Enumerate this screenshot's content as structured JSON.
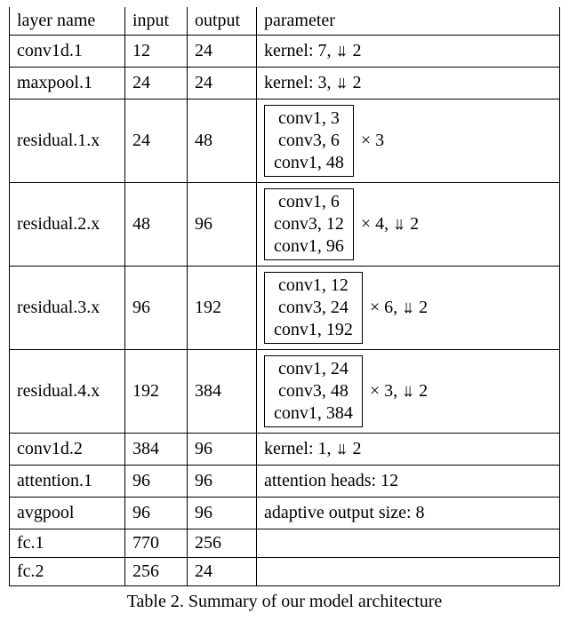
{
  "headers": {
    "layer": "layer name",
    "input": "input",
    "output": "output",
    "param": "parameter"
  },
  "glyphs": {
    "downsample": "↓↓",
    "times": "×"
  },
  "rows": [
    {
      "layer": "conv1d.1",
      "input": "12",
      "output": "24",
      "param_text": "kernel: 7, ↓↓ 2"
    },
    {
      "layer": "maxpool.1",
      "input": "24",
      "output": "24",
      "param_text": "kernel: 3, ↓↓ 2"
    },
    {
      "layer": "residual.1.x",
      "input": "24",
      "output": "48",
      "block": {
        "lines": [
          "conv1, 3",
          "conv3, 6",
          "conv1, 48"
        ]
      },
      "after": "× 3"
    },
    {
      "layer": "residual.2.x",
      "input": "48",
      "output": "96",
      "block": {
        "lines": [
          "conv1, 6",
          "conv3, 12",
          "conv1, 96"
        ]
      },
      "after": "× 4, ↓↓ 2"
    },
    {
      "layer": "residual.3.x",
      "input": "96",
      "output": "192",
      "block": {
        "lines": [
          "conv1, 12",
          "conv3, 24",
          "conv1, 192"
        ]
      },
      "after": "× 6, ↓↓ 2"
    },
    {
      "layer": "residual.4.x",
      "input": "192",
      "output": "384",
      "block": {
        "lines": [
          "conv1, 24",
          "conv3, 48",
          "conv1, 384"
        ]
      },
      "after": "× 3, ↓↓ 2"
    },
    {
      "layer": "conv1d.2",
      "input": "384",
      "output": "96",
      "param_text": "kernel: 1, ↓↓ 2"
    },
    {
      "layer": "attention.1",
      "input": "96",
      "output": "96",
      "param_text": "attention heads: 12"
    },
    {
      "layer": "avgpool",
      "input": "96",
      "output": "96",
      "param_text": "adaptive output size: 8"
    },
    {
      "layer": "fc.1",
      "input": "770",
      "output": "256",
      "param_text": ""
    },
    {
      "layer": "fc.2",
      "input": "256",
      "output": "24",
      "param_text": ""
    }
  ],
  "caption": "Table 2.  Summary of our model architecture",
  "chart_data": {
    "type": "table",
    "title": "Summary of our model architecture",
    "columns": [
      "layer name",
      "input",
      "output",
      "parameter"
    ],
    "rows": [
      [
        "conv1d.1",
        12,
        24,
        "kernel: 7, stride 2"
      ],
      [
        "maxpool.1",
        24,
        24,
        "kernel: 3, stride 2"
      ],
      [
        "residual.1.x",
        24,
        48,
        "[conv1,3; conv3,6; conv1,48] × 3"
      ],
      [
        "residual.2.x",
        48,
        96,
        "[conv1,6; conv3,12; conv1,96] × 4, stride 2"
      ],
      [
        "residual.3.x",
        96,
        192,
        "[conv1,12; conv3,24; conv1,192] × 6, stride 2"
      ],
      [
        "residual.4.x",
        192,
        384,
        "[conv1,24; conv3,48; conv1,384] × 3, stride 2"
      ],
      [
        "conv1d.2",
        384,
        96,
        "kernel: 1, stride 2"
      ],
      [
        "attention.1",
        96,
        96,
        "attention heads: 12"
      ],
      [
        "avgpool",
        96,
        96,
        "adaptive output size: 8"
      ],
      [
        "fc.1",
        770,
        256,
        ""
      ],
      [
        "fc.2",
        256,
        24,
        ""
      ]
    ]
  }
}
